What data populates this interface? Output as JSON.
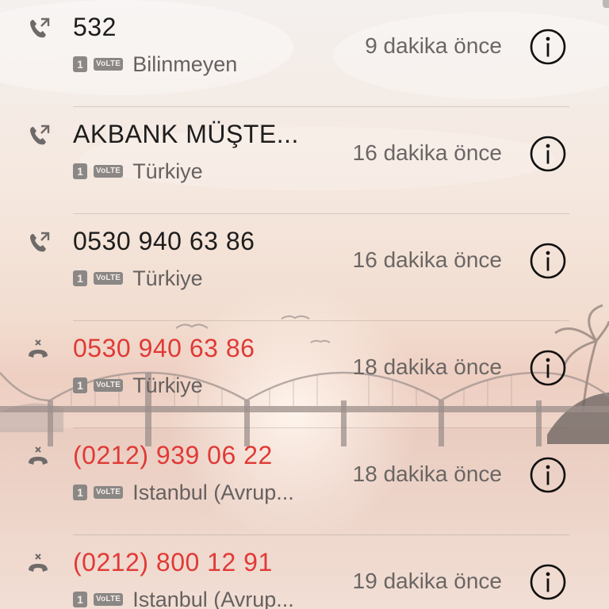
{
  "colors": {
    "missed": "#e03a36",
    "normal_text": "#1d1d1d",
    "secondary_text": "#666160"
  },
  "calls": [
    {
      "name": "532",
      "sim": "1",
      "volte": "VoLTE",
      "location": "Bilinmeyen",
      "time": "9 dakika önce",
      "type": "outgoing",
      "icon": "outgoing-call-icon"
    },
    {
      "name": "AKBANK MÜŞTE...",
      "sim": "1",
      "volte": "VoLTE",
      "location": "Türkiye",
      "time": "16 dakika önce",
      "type": "outgoing",
      "icon": "outgoing-call-icon"
    },
    {
      "name": "0530 940 63 86",
      "sim": "1",
      "volte": "VoLTE",
      "location": "Türkiye",
      "time": "16 dakika önce",
      "type": "outgoing",
      "icon": "outgoing-call-icon"
    },
    {
      "name": "0530 940 63 86",
      "sim": "1",
      "volte": "VoLTE",
      "location": "Türkiye",
      "time": "18 dakika önce",
      "type": "missed",
      "icon": "missed-call-icon"
    },
    {
      "name": "(0212) 939 06 22",
      "sim": "1",
      "volte": "VoLTE",
      "location": "Istanbul (Avrup...",
      "time": "18 dakika önce",
      "type": "missed",
      "icon": "missed-call-icon"
    },
    {
      "name": "(0212) 800 12 91",
      "sim": "1",
      "volte": "VoLTE",
      "location": "Istanbul (Avrup...",
      "time": "19 dakika önce",
      "type": "missed",
      "icon": "missed-call-icon"
    }
  ]
}
